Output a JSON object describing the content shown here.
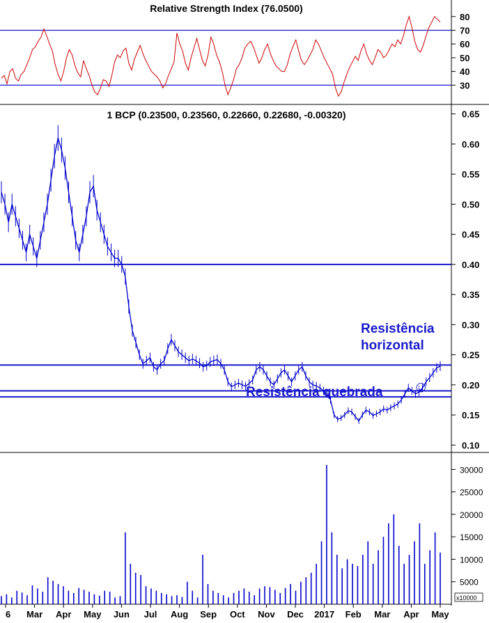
{
  "chart_data": [
    {
      "type": "line",
      "panel": "rsi",
      "title": "Relative Strength Index (76.0500)",
      "ylim": [
        18,
        88
      ],
      "yticks": [
        30,
        40,
        50,
        60,
        70,
        80
      ],
      "reference_lines": [
        70,
        30
      ],
      "series": [
        {
          "color": "#cc0000",
          "values": [
            35,
            37,
            31,
            40,
            42,
            35,
            33,
            38,
            40,
            45,
            50,
            56,
            58,
            62,
            65,
            71,
            66,
            60,
            55,
            45,
            38,
            33,
            40,
            50,
            56,
            52,
            44,
            39,
            36,
            48,
            42,
            37,
            30,
            25,
            23,
            28,
            34,
            33,
            29,
            37,
            47,
            52,
            50,
            55,
            57,
            46,
            41,
            49,
            54,
            59,
            53,
            48,
            44,
            40,
            38,
            36,
            33,
            28,
            31,
            37,
            42,
            47,
            68,
            60,
            55,
            46,
            41,
            50,
            57,
            64,
            56,
            48,
            44,
            52,
            65,
            60,
            52,
            47,
            40,
            30,
            23,
            28,
            34,
            42,
            45,
            50,
            57,
            60,
            62,
            58,
            52,
            46,
            50,
            56,
            60,
            53,
            48,
            44,
            42,
            40,
            40,
            45,
            53,
            58,
            63,
            55,
            48,
            45,
            48,
            52,
            56,
            63,
            60,
            55,
            50,
            46,
            42,
            38,
            28,
            22,
            25,
            32,
            38,
            43,
            47,
            51,
            48,
            55,
            60,
            53,
            48,
            45,
            50,
            56,
            54,
            50,
            52,
            56,
            60,
            58,
            63,
            60,
            66,
            74,
            80,
            72,
            62,
            56,
            54,
            59,
            66,
            72,
            76,
            80,
            78,
            76
          ]
        }
      ]
    },
    {
      "type": "line",
      "panel": "price",
      "title": "1 BCP (0.23500, 0.23560, 0.22660, 0.22680, -0.00320)",
      "ylim": [
        0.09,
        0.66
      ],
      "yticks": [
        "0.65",
        "0.60",
        "0.55",
        "0.50",
        "0.45",
        "0.40",
        "0.35",
        "0.30",
        "0.25",
        "0.20",
        "0.15",
        "0.10"
      ],
      "horizontal_lines": [
        0.4,
        0.233,
        0.19,
        0.18
      ],
      "annotations": [
        "Resistência horizontal",
        "Resistência quebrada",
        "☺"
      ],
      "series": [
        {
          "color": "#0000cc",
          "values": [
            0.52,
            0.5,
            0.47,
            0.5,
            0.48,
            0.46,
            0.44,
            0.42,
            0.45,
            0.43,
            0.41,
            0.44,
            0.47,
            0.5,
            0.54,
            0.58,
            0.61,
            0.59,
            0.56,
            0.52,
            0.48,
            0.44,
            0.42,
            0.45,
            0.48,
            0.52,
            0.53,
            0.49,
            0.47,
            0.45,
            0.43,
            0.42,
            0.41,
            0.41,
            0.4,
            0.38,
            0.33,
            0.29,
            0.27,
            0.25,
            0.235,
            0.24,
            0.245,
            0.23,
            0.225,
            0.235,
            0.24,
            0.26,
            0.275,
            0.265,
            0.255,
            0.25,
            0.245,
            0.24,
            0.243,
            0.24,
            0.236,
            0.23,
            0.232,
            0.238,
            0.24,
            0.242,
            0.235,
            0.225,
            0.205,
            0.197,
            0.2,
            0.203,
            0.2,
            0.198,
            0.202,
            0.208,
            0.225,
            0.23,
            0.225,
            0.215,
            0.205,
            0.2,
            0.21,
            0.22,
            0.225,
            0.215,
            0.205,
            0.215,
            0.225,
            0.23,
            0.215,
            0.205,
            0.2,
            0.198,
            0.195,
            0.19,
            0.185,
            0.175,
            0.15,
            0.143,
            0.145,
            0.15,
            0.157,
            0.155,
            0.147,
            0.14,
            0.15,
            0.158,
            0.155,
            0.149,
            0.152,
            0.155,
            0.16,
            0.158,
            0.162,
            0.165,
            0.168,
            0.175,
            0.185,
            0.195,
            0.19,
            0.185,
            0.188,
            0.195,
            0.205,
            0.212,
            0.22,
            0.228,
            0.231
          ]
        }
      ]
    },
    {
      "type": "bar",
      "panel": "volume",
      "ylim": [
        0,
        33000
      ],
      "yticks": [
        "30000",
        "25000",
        "20000",
        "15000",
        "10000",
        "5000"
      ],
      "unit_label": "x10000",
      "xtick_labels": [
        "6",
        "Mar",
        "Apr",
        "May",
        "Jun",
        "Jul",
        "Aug",
        "Sep",
        "Oct",
        "Nov",
        "Dec",
        "2017",
        "Feb",
        "Mar",
        "Apr",
        "May"
      ],
      "series": [
        {
          "color": "#0000cc",
          "values": [
            1800,
            2200,
            1500,
            3000,
            2600,
            2000,
            4200,
            3500,
            2800,
            6000,
            5200,
            4500,
            4000,
            3000,
            2500,
            3600,
            3200,
            2800,
            2200,
            1900,
            3000,
            2800,
            1500,
            1800,
            16000,
            9000,
            7000,
            6500,
            4000,
            3500,
            3000,
            2500,
            2200,
            1800,
            2000,
            1600,
            5000,
            3000,
            1500,
            11000,
            4500,
            3000,
            2500,
            2000,
            1500,
            2500,
            3000,
            3500,
            2800,
            2000,
            3500,
            4000,
            3800,
            3200,
            2500,
            3600,
            4500,
            3000,
            5000,
            6000,
            7000,
            9000,
            14000,
            31000,
            16000,
            11000,
            8000,
            10000,
            9000,
            8500,
            11000,
            14000,
            9000,
            12000,
            15000,
            18000,
            20000,
            13000,
            9000,
            11000,
            14000,
            18000,
            9000,
            12000,
            16000,
            11500
          ]
        }
      ]
    }
  ]
}
